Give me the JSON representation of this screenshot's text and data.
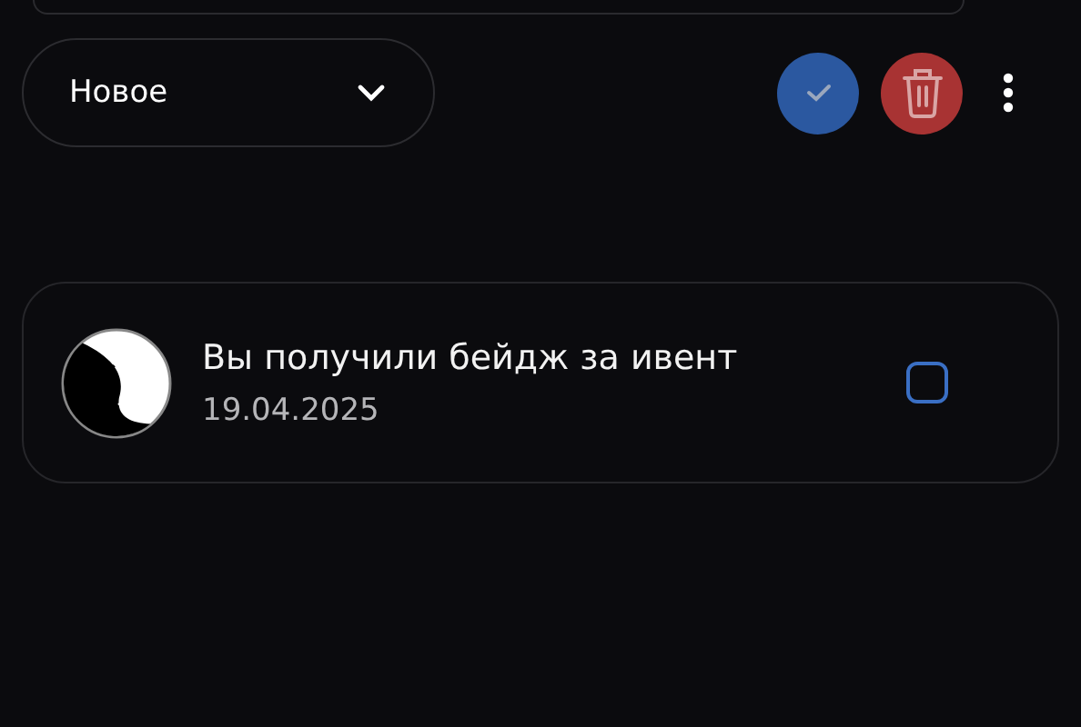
{
  "filter": {
    "value": "Новое"
  },
  "notifications": [
    {
      "title": "Вы получили бейдж за ивент",
      "date": "19.04.2025",
      "checked": false
    }
  ]
}
